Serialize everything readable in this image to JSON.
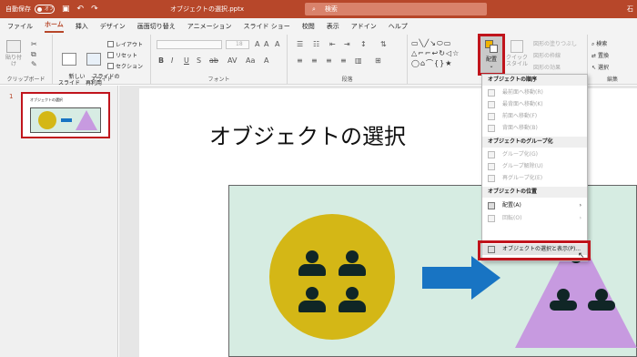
{
  "titlebar": {
    "autosave_label": "自動保存",
    "autosave_state": "オフ",
    "filename": "オブジェクトの選択.pptx",
    "search_label": "検索",
    "right_text": "石"
  },
  "tabs": [
    "ファイル",
    "ホーム",
    "挿入",
    "デザイン",
    "画面切り替え",
    "アニメーション",
    "スライド ショー",
    "校閲",
    "表示",
    "アドイン",
    "ヘルプ"
  ],
  "active_tab": "ホーム",
  "ribbon": {
    "groups": {
      "clipboard": "クリップボード",
      "slides": "スライド",
      "font": "フォント",
      "paragraph": "段落",
      "edit": "編集"
    },
    "paste": "貼り付け",
    "new_slide": "新しい\nスライド",
    "reuse_slide": "スライドの\n再利用",
    "layout": "レイアウト",
    "reset": "リセット",
    "section": "セクション",
    "font_size": "18",
    "arrange": "配置",
    "quick_style": "クイック\nスタイル",
    "shape_fill": "図形の塗りつぶし",
    "shape_outline": "図形の枠線",
    "shape_effect": "図形の効果",
    "find": "検索",
    "replace": "置換",
    "select": "選択"
  },
  "thumbnail": {
    "number": "1",
    "title": "オブジェクトの選択"
  },
  "slide": {
    "title": "オブジェクトの選択"
  },
  "menu": {
    "sections": [
      {
        "header": "オブジェクトの順序",
        "items": [
          {
            "label": "最前面へ移動(R)",
            "enabled": false
          },
          {
            "label": "最背面へ移動(K)",
            "enabled": false
          },
          {
            "label": "前面へ移動(F)",
            "enabled": false
          },
          {
            "label": "背面へ移動(B)",
            "enabled": false
          }
        ]
      },
      {
        "header": "オブジェクトのグループ化",
        "items": [
          {
            "label": "グループ化(G)",
            "enabled": false
          },
          {
            "label": "グループ解除(U)",
            "enabled": false
          },
          {
            "label": "再グループ化(E)",
            "enabled": false
          }
        ]
      },
      {
        "header": "オブジェクトの位置",
        "items": [
          {
            "label": "配置(A)",
            "enabled": true,
            "submenu": true
          },
          {
            "label": "回転(O)",
            "enabled": false,
            "submenu": true
          },
          {
            "label": "オブジェクトの選択と表示(P)...",
            "enabled": true,
            "highlight": true
          }
        ]
      }
    ]
  },
  "colors": {
    "brand": "#b7472a",
    "highlight_box": "#c0141c",
    "circle": "#d4b716",
    "triangle": "#c79ae0",
    "arrow": "#1874c3",
    "content_bg": "#d6ece2"
  }
}
